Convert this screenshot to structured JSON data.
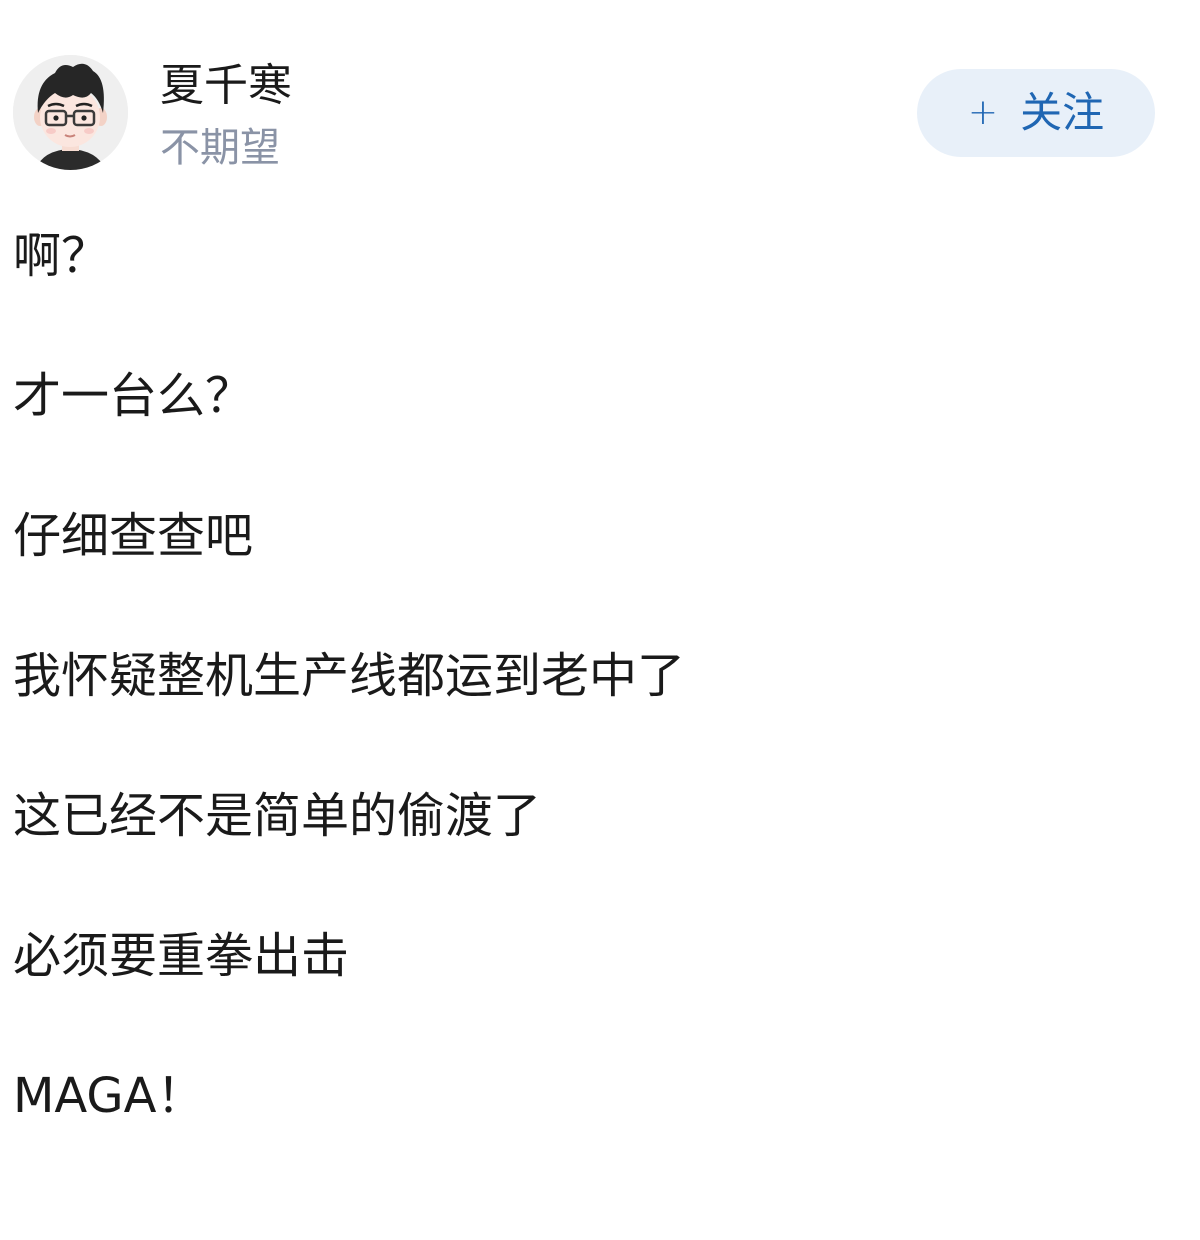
{
  "author": {
    "name": "夏千寒",
    "signature": "不期望",
    "avatar_icon": "cartoon-avatar-with-glasses"
  },
  "follow_button": {
    "plus": "+",
    "label": "关注",
    "text_color": "#1f66b3",
    "bg_color": "#e8f0f9"
  },
  "post": {
    "lines": [
      "啊？",
      "才一台么？",
      "仔细查查吧",
      "我怀疑整机生产线都运到老中了",
      "这已经不是简单的偷渡了",
      "必须要重拳出击",
      "MAGA！"
    ]
  }
}
